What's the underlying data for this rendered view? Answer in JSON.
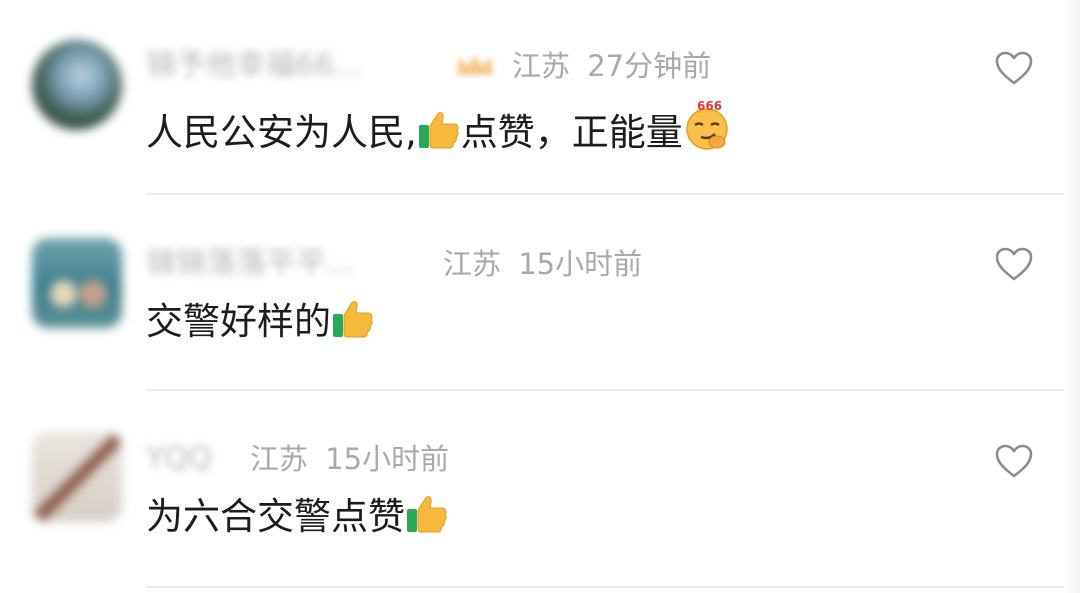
{
  "comments": [
    {
      "username": "锦予他幸福66...",
      "location": "江苏",
      "time": "27分钟前",
      "text_part1": "人民公安为人民,",
      "text_part2": "点赞，正能量",
      "emojis": [
        "thumbs-up",
        "666-smirk"
      ]
    },
    {
      "username": "锦锦落落平平...",
      "location": "江苏",
      "time": "15小时前",
      "text_part1": "交警好样的",
      "emojis": [
        "thumbs-up"
      ]
    },
    {
      "username": "YQQ",
      "location": "江苏",
      "time": "15小时前",
      "text_part1": "为六合交警点赞",
      "emojis": [
        "thumbs-up"
      ]
    }
  ],
  "emoji_labels": {
    "666": "666"
  },
  "colors": {
    "text": "#1c1c1c",
    "meta": "#a9a9a9",
    "divider": "#ececec",
    "badge": "#f6c88a"
  }
}
